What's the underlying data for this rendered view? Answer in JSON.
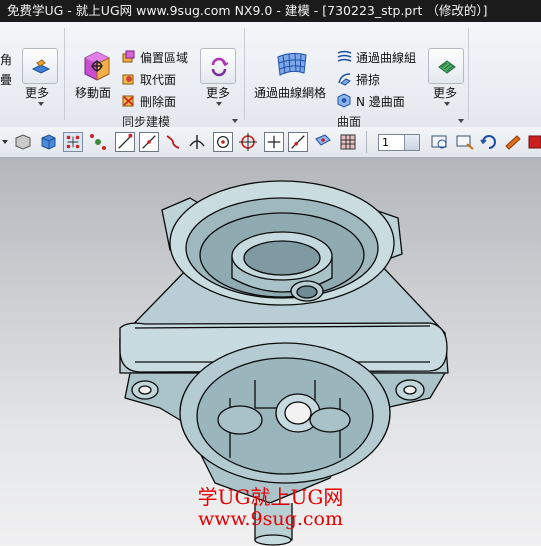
{
  "window": {
    "title": "免费学UG - 就上UG网 www.9sug.com NX9.0 - 建模 - [730223_stp.prt （修改的）]"
  },
  "ribbon": {
    "left_group": {
      "top_label": "角",
      "mid_label": "疊",
      "more_label": "更多"
    },
    "sync_group": {
      "move_face_label": "移動面",
      "offset_region_label": "偏置區域",
      "replace_face_label": "取代面",
      "delete_face_label": "刪除面",
      "more_label": "更多",
      "group_title": "同步建模"
    },
    "surface_group": {
      "curve_mesh_label": "通過曲線網格",
      "through_curves_label": "通過曲線組",
      "sweep_label": "掃掠",
      "n_sided_label": "N 邊曲面",
      "more_label": "更多",
      "group_title": "曲面"
    }
  },
  "toolbar": {
    "zoom_value": "1"
  },
  "watermark": {
    "line1": "学UG就上UG网",
    "line2": "www.9sug.com"
  },
  "colors": {
    "titlebar_bg": "#1b1b1b",
    "model_body": "#bcd3d8",
    "model_edges": "#0b0b0b",
    "watermark": "#e60000",
    "viewport_top": "#b3b6bb",
    "viewport_bottom": "#f1f1f2"
  }
}
